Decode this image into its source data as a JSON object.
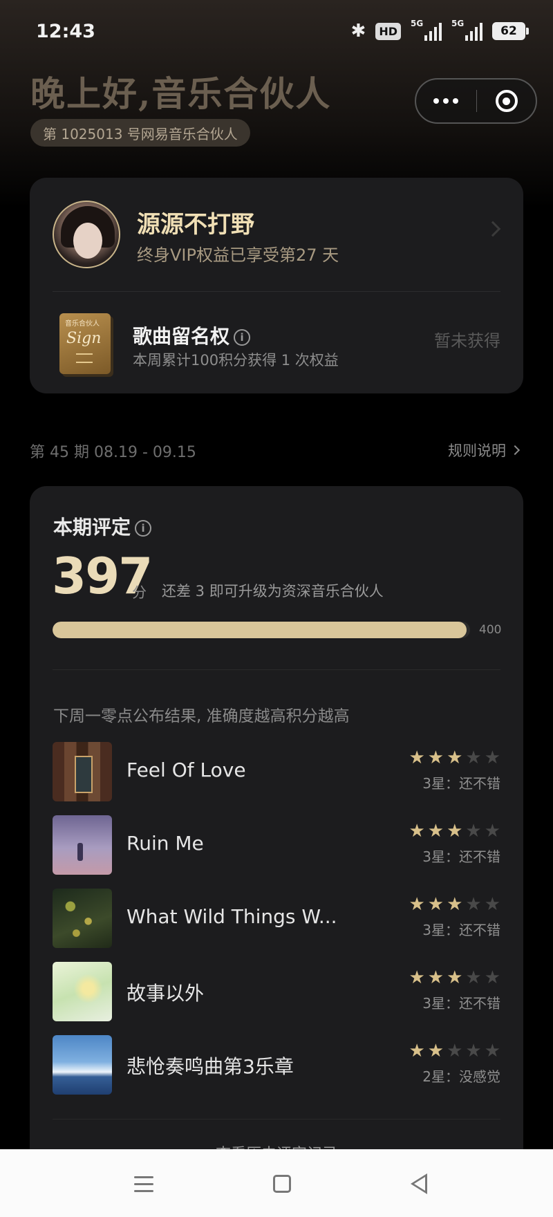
{
  "status_bar": {
    "time": "12:43",
    "network_label": "5G",
    "network_label_2": "5G",
    "hd_label": "HD",
    "battery": "62"
  },
  "header": {
    "greeting": "晚上好,音乐合伙人",
    "partner_number": "第 1025013 号网易音乐合伙人"
  },
  "user": {
    "name": "源源不打野",
    "vip_text": "终身VIP权益已享受第27 天"
  },
  "benefit": {
    "icon_top": "音乐合伙人",
    "icon_sig": "Sign",
    "title": "歌曲留名权",
    "info_glyph": "i",
    "subtitle": "本周累计100积分获得 1 次权益",
    "status": "暂未获得"
  },
  "period": {
    "label": "第 45 期 08.19 - 09.15",
    "rules_link": "规则说明"
  },
  "rating": {
    "title": "本期评定",
    "info_glyph": "i",
    "score": "397",
    "unit": "分",
    "hint": "还差 3 即可升级为资深音乐合伙人",
    "progress": 0.9925,
    "progress_max": "400",
    "publish_note": "下周一零点公布结果, 准确度越高积分越高",
    "history_link": "查看历史评定记录"
  },
  "songs": [
    {
      "title": "Feel Of Love",
      "stars": 3,
      "label": "3星：还不错"
    },
    {
      "title": "Ruin Me",
      "stars": 3,
      "label": "3星：还不错"
    },
    {
      "title": "What Wild Things W...",
      "stars": 3,
      "label": "3星：还不错"
    },
    {
      "title": "故事以外",
      "stars": 3,
      "label": "3星：还不错"
    },
    {
      "title": "悲怆奏鸣曲第3乐章",
      "stars": 2,
      "label": "2星：没感觉"
    }
  ],
  "colors": {
    "accent_gold": "#d9c69a",
    "star_on": "#d8c08a",
    "star_off": "#494949"
  }
}
